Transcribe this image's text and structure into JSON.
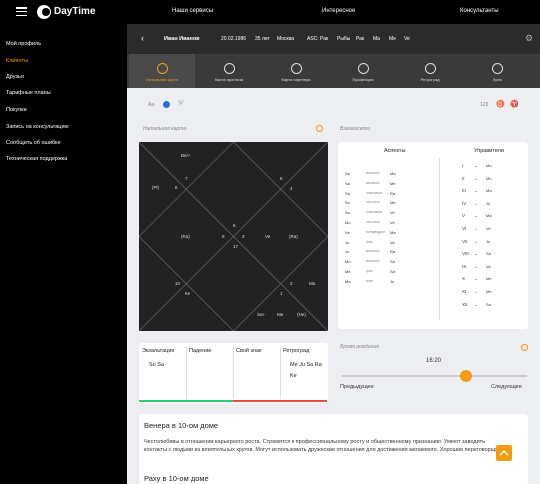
{
  "topbar": {
    "brand": "DayTime",
    "nav": [
      "Наши сервисы",
      "Интересное",
      "Консультанты"
    ]
  },
  "sidebar": {
    "items": [
      "Мой профиль",
      "Клиенты",
      "Друзья",
      "Тарифные планы",
      "Покупки",
      "Запись на консультацию",
      "Сообщить об ошибке",
      "Техническая поддержка"
    ]
  },
  "header": {
    "name": "Иван Иванов",
    "date": "20.02.1986",
    "age": "35 лет",
    "city": "Москва",
    "asc": "ASC: Рак",
    "moon": "Рыбы",
    "sun": "Рак",
    "f1": "Ma",
    "f2": "Me",
    "f3": "Ve"
  },
  "tabs": [
    "Натальная карта",
    "Карта прогноза",
    "Карта партнера",
    "Профекции",
    "Ретроград",
    "Луна"
  ],
  "labels": {
    "natal": "Натальная карта",
    "mutual": "Взаимосвязи",
    "time": "Время рождения",
    "prev": "Предыдущее",
    "next": "Следующее",
    "aspects": "Аспекты",
    "rulers": "Управители",
    "timeval": "16:20"
  },
  "small_left": "Аа",
  "small_right": "123",
  "chart": {
    "top": "Ве/+",
    "k1": "К",
    "n7": "7",
    "n5": "5",
    "n4": "4",
    "n8": "8",
    "n6": "6",
    "n3": "3",
    "n17": "17",
    "n10": "10",
    "n2": "2",
    "n1": "1",
    "ma": "Ма",
    "sa": "Sa+",
    "me": "Ме",
    "ju": "Ju",
    "ve": "Ve",
    "ra": "(Ra)",
    "rb": "(Ra)",
    "pl": "(Pl)",
    "mo": "Мо",
    "ke": "Ке",
    "ne": "(Ne)"
  },
  "aspects": [
    [
      "Sa",
      "квинконс",
      "Ma"
    ],
    [
      "Sa",
      "квинконс",
      "Me"
    ],
    [
      "Sa",
      "оппозиция",
      "Ra"
    ],
    [
      "Su",
      "секстиль",
      "Me"
    ],
    [
      "Su",
      "оппозиция",
      "Ve"
    ],
    [
      "Mo",
      "секстиль",
      "Ve"
    ],
    [
      "Ve",
      "полуквадрат",
      "Ma"
    ],
    [
      "Ju",
      "трин",
      "Ve"
    ],
    [
      "Ju",
      "квинконс",
      "Ra"
    ],
    [
      "Mo",
      "квинконс",
      "Sa"
    ],
    [
      "Me",
      "трин",
      "Sa"
    ],
    [
      "Ma",
      "трин",
      "Ju"
    ]
  ],
  "rulers": [
    [
      "I",
      "Mo"
    ],
    [
      "II",
      "Mo"
    ],
    [
      "III",
      "Ma"
    ],
    [
      "IV",
      "Ju"
    ],
    [
      "V",
      "Ma"
    ],
    [
      "VI",
      "Ve"
    ],
    [
      "VII",
      "Ju"
    ],
    [
      "VIII",
      "Sa"
    ],
    [
      "IX",
      "Ve"
    ],
    [
      "X",
      "Me"
    ],
    [
      "XI",
      "Me"
    ],
    [
      "XII",
      "Sa"
    ]
  ],
  "status": {
    "headers": [
      "Экзальтация",
      "Падение",
      "Свой знак",
      "Ретроград"
    ],
    "vals": [
      "Su Sa",
      "",
      "",
      "Me Ju Sa Ra Ke"
    ],
    "colors": [
      "#2ecc71",
      "#2ecc71",
      "#e74c3c",
      "#e74c3c"
    ]
  },
  "text": {
    "title": "Венера в 10-ом доме",
    "body": "Честолюбивы в отношении карьерного роста. Стремятся к профессиональному росту и общественному признанию. Умеют заводить контакты с людьми из влиятельных кругов. Могут использовать дружеские отношения для достижения желаемого. Хорошие переговорщики.",
    "title2": "Раху в 10-ом доме"
  }
}
